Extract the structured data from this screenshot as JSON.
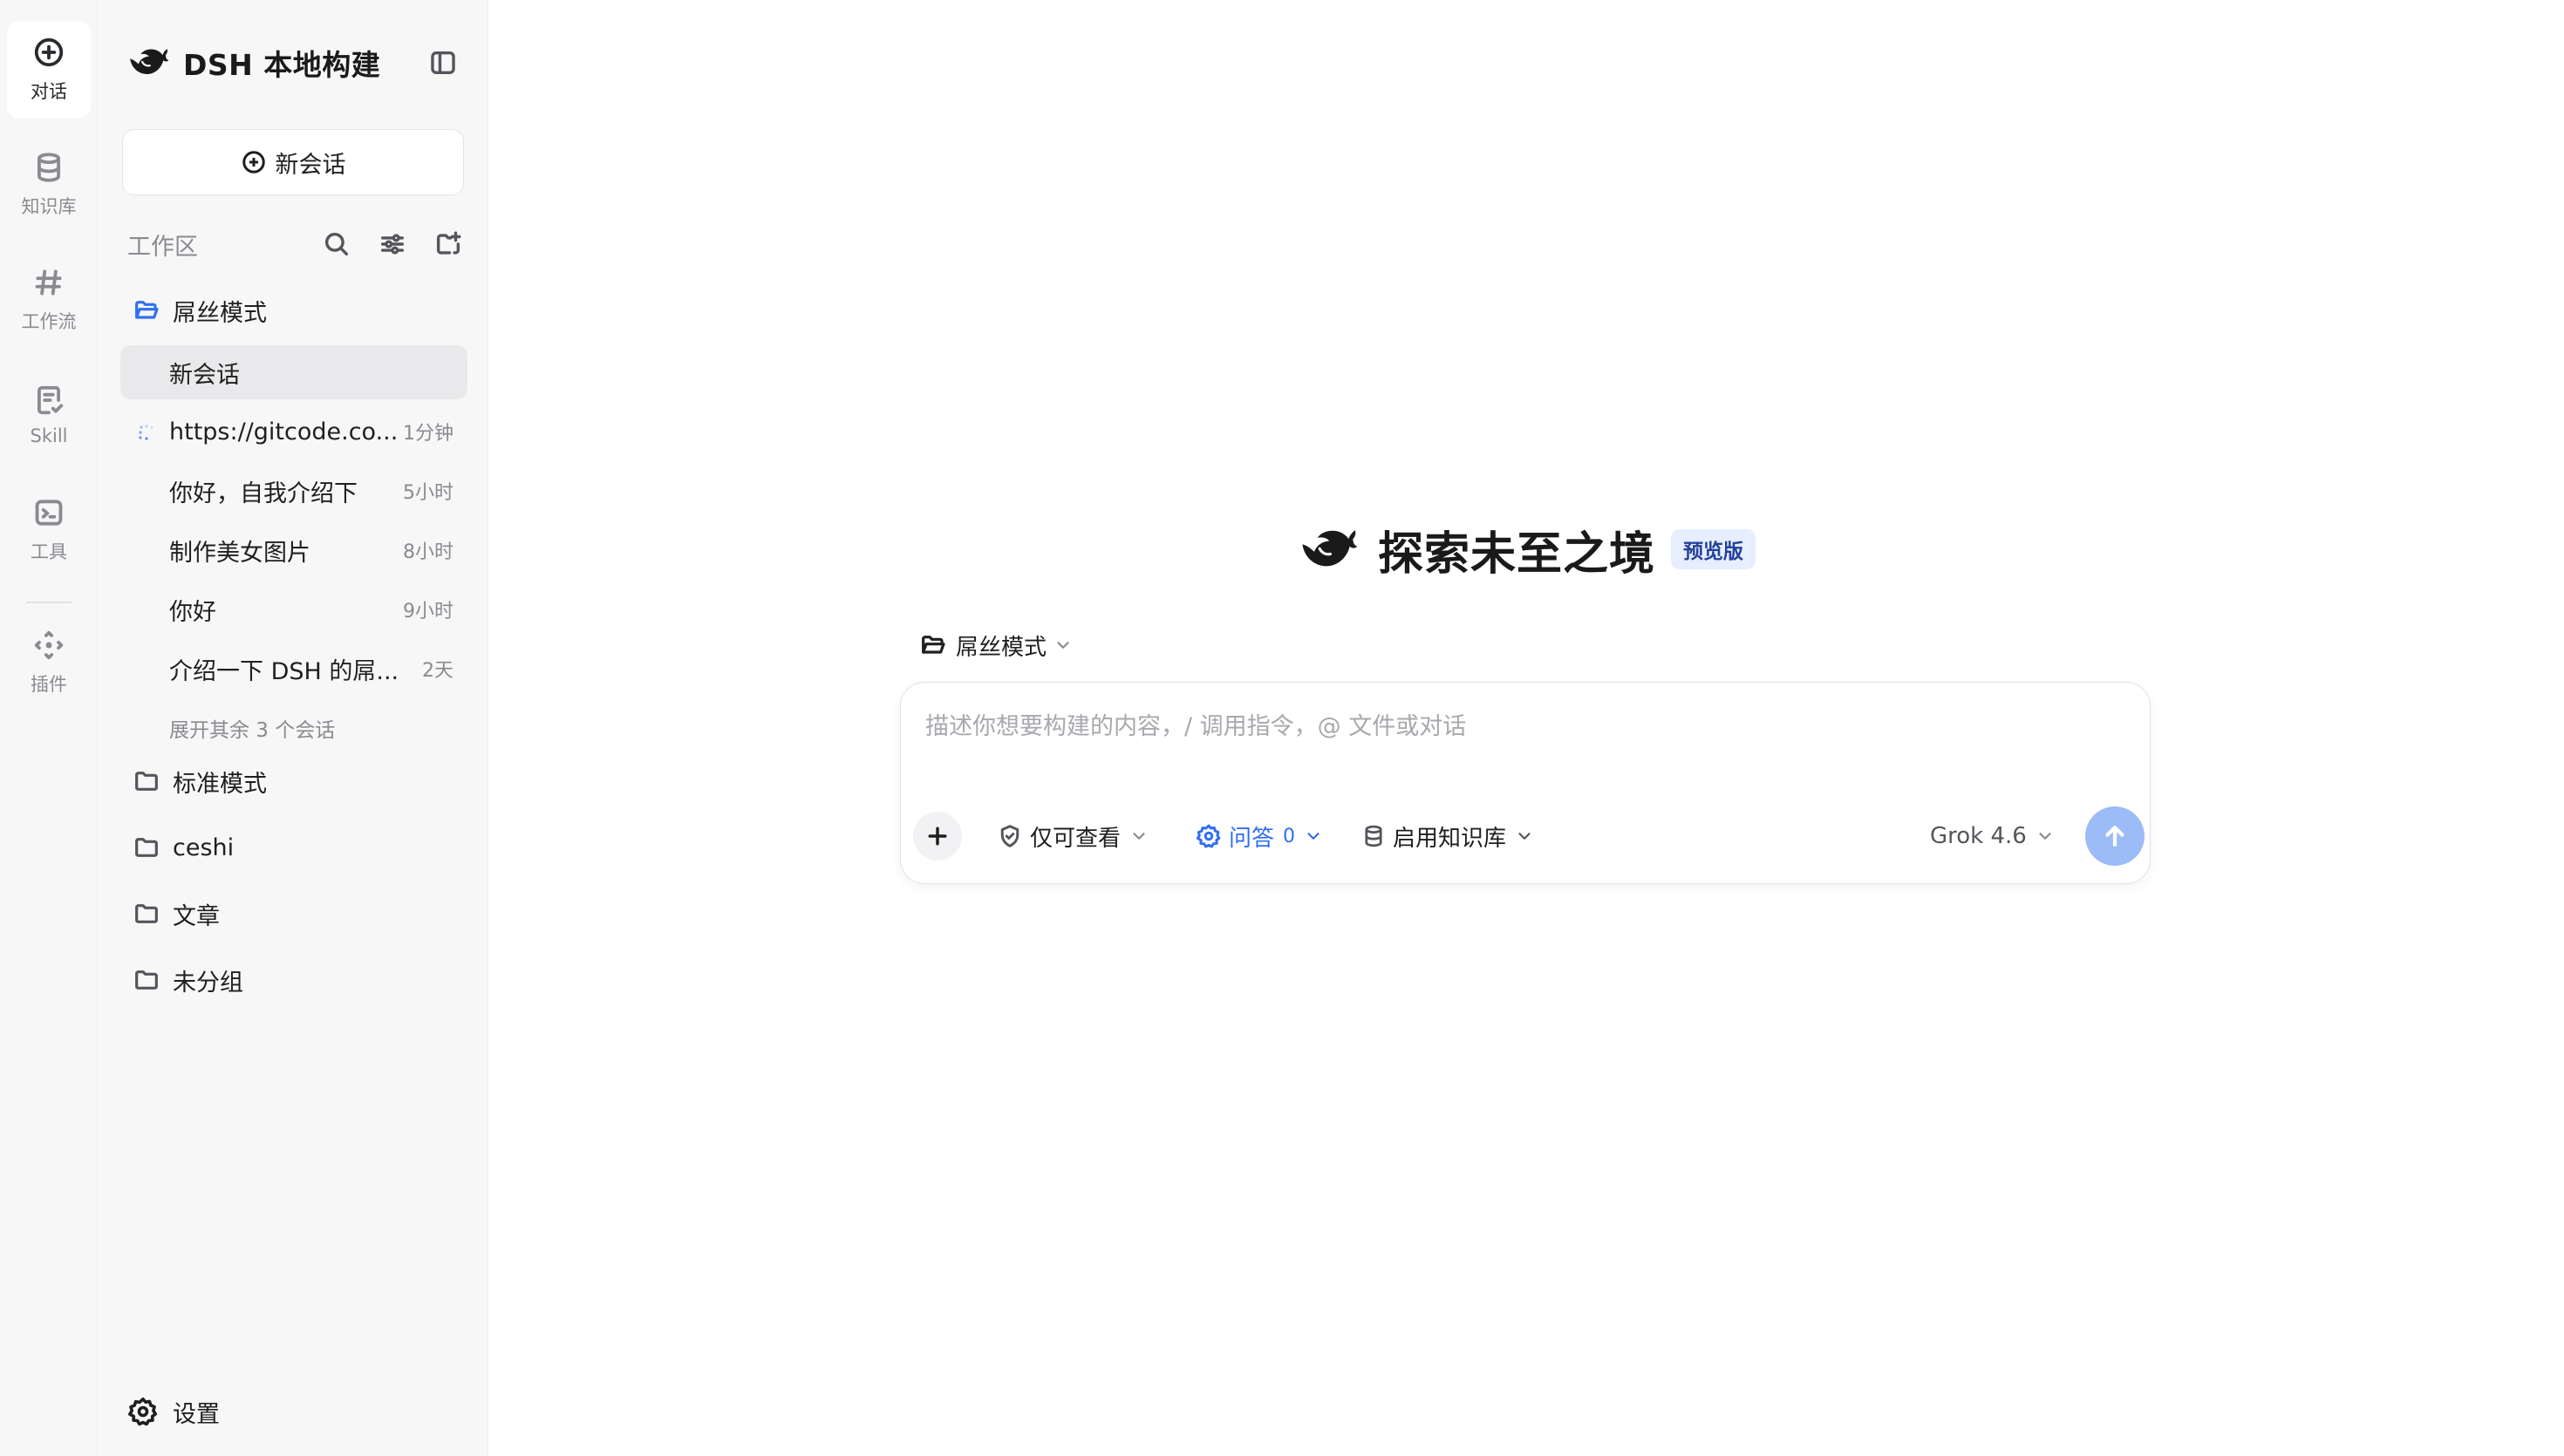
{
  "rail": {
    "items": [
      {
        "label": "对话",
        "icon": "plus-circle-icon",
        "active": true
      },
      {
        "label": "知识库",
        "icon": "database-icon"
      },
      {
        "label": "工作流",
        "icon": "hash-icon"
      },
      {
        "label": "Skill",
        "icon": "skill-doc-icon"
      },
      {
        "label": "工具",
        "icon": "terminal-icon"
      },
      {
        "label": "插件",
        "icon": "plugin-move-icon"
      }
    ]
  },
  "sidebar": {
    "brand_title": "DSH 本地构建",
    "new_chat_label": "新会话",
    "workspace_title": "工作区",
    "folders": [
      {
        "name": "屌丝模式",
        "open": true
      },
      {
        "name": "标准模式"
      },
      {
        "name": "ceshi"
      },
      {
        "name": "文章"
      },
      {
        "name": "未分组"
      }
    ],
    "conversations": [
      {
        "title": "新会话",
        "time": "",
        "active": true
      },
      {
        "title": "https://gitcode.co...",
        "time": "1分钟",
        "loading": true
      },
      {
        "title": "你好，自我介绍下",
        "time": "5小时"
      },
      {
        "title": "制作美女图片",
        "time": "8小时"
      },
      {
        "title": "你好",
        "time": "9小时"
      },
      {
        "title": "介绍一下 DSH 的屌...",
        "time": "2天"
      }
    ],
    "expand_more": "展开其余 3 个会话",
    "settings_label": "设置"
  },
  "main": {
    "hero_title": "探索未至之境",
    "hero_badge": "预览版",
    "mode_label": "屌丝模式",
    "composer": {
      "placeholder": "描述你想要构建的内容，/ 调用指令，@ 文件或对话",
      "access_label": "仅可查看",
      "qa_label": "问答",
      "qa_count": "0",
      "kb_label": "启用知识库",
      "model_label": "Grok 4.6"
    }
  },
  "colors": {
    "accent": "#2f6ff0",
    "send_button": "#9cbcf7",
    "badge_bg": "#e6eeff",
    "sidebar_bg": "#f7f7f8"
  }
}
